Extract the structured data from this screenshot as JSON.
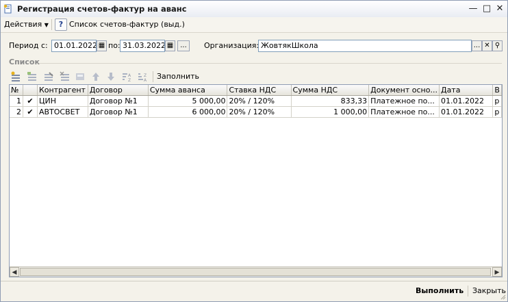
{
  "window": {
    "title": "Регистрация счетов-фактур на аванс",
    "controls": [
      "minimize",
      "maximize",
      "close"
    ]
  },
  "menu": {
    "actions_label": "Действия",
    "help_label": "?",
    "list_label": "Список счетов-фактур (выд.)"
  },
  "filters": {
    "period_label": "Период с:",
    "date_from": "01.01.2022",
    "to_label": "по:",
    "date_to": "31.03.2022",
    "ellipsis": "...",
    "org_label": "Организация:",
    "org_value": "ЖовтякШкола"
  },
  "section": {
    "title": "Список",
    "fill_label": "Заполнить"
  },
  "table": {
    "columns": [
      "№",
      "",
      "Контрагент",
      "Договор",
      "Сумма аванса",
      "Ставка НДС",
      "Сумма НДС",
      "Документ осно...",
      "Дата",
      "В"
    ],
    "rows": [
      {
        "n": "1",
        "check": "✔",
        "counterparty": "ЦИН",
        "contract": "Договор №1",
        "advance": "5 000,00",
        "rate": "20% / 120%",
        "vat": "833,33",
        "doc": "Платежное по...",
        "date": "01.01.2022",
        "v": "р"
      },
      {
        "n": "2",
        "check": "✔",
        "counterparty": "АВТОСВЕТ",
        "contract": "Договор №1",
        "advance": "6 000,00",
        "rate": "20% / 120%",
        "vat": "1 000,00",
        "doc": "Платежное по...",
        "date": "01.01.2022",
        "v": "р"
      }
    ]
  },
  "footer": {
    "run_label": "Выполнить",
    "close_label": "Закрыть"
  },
  "colors": {
    "accent_icon": "#2f6fd6",
    "window_bg": "#f4f2ea"
  }
}
